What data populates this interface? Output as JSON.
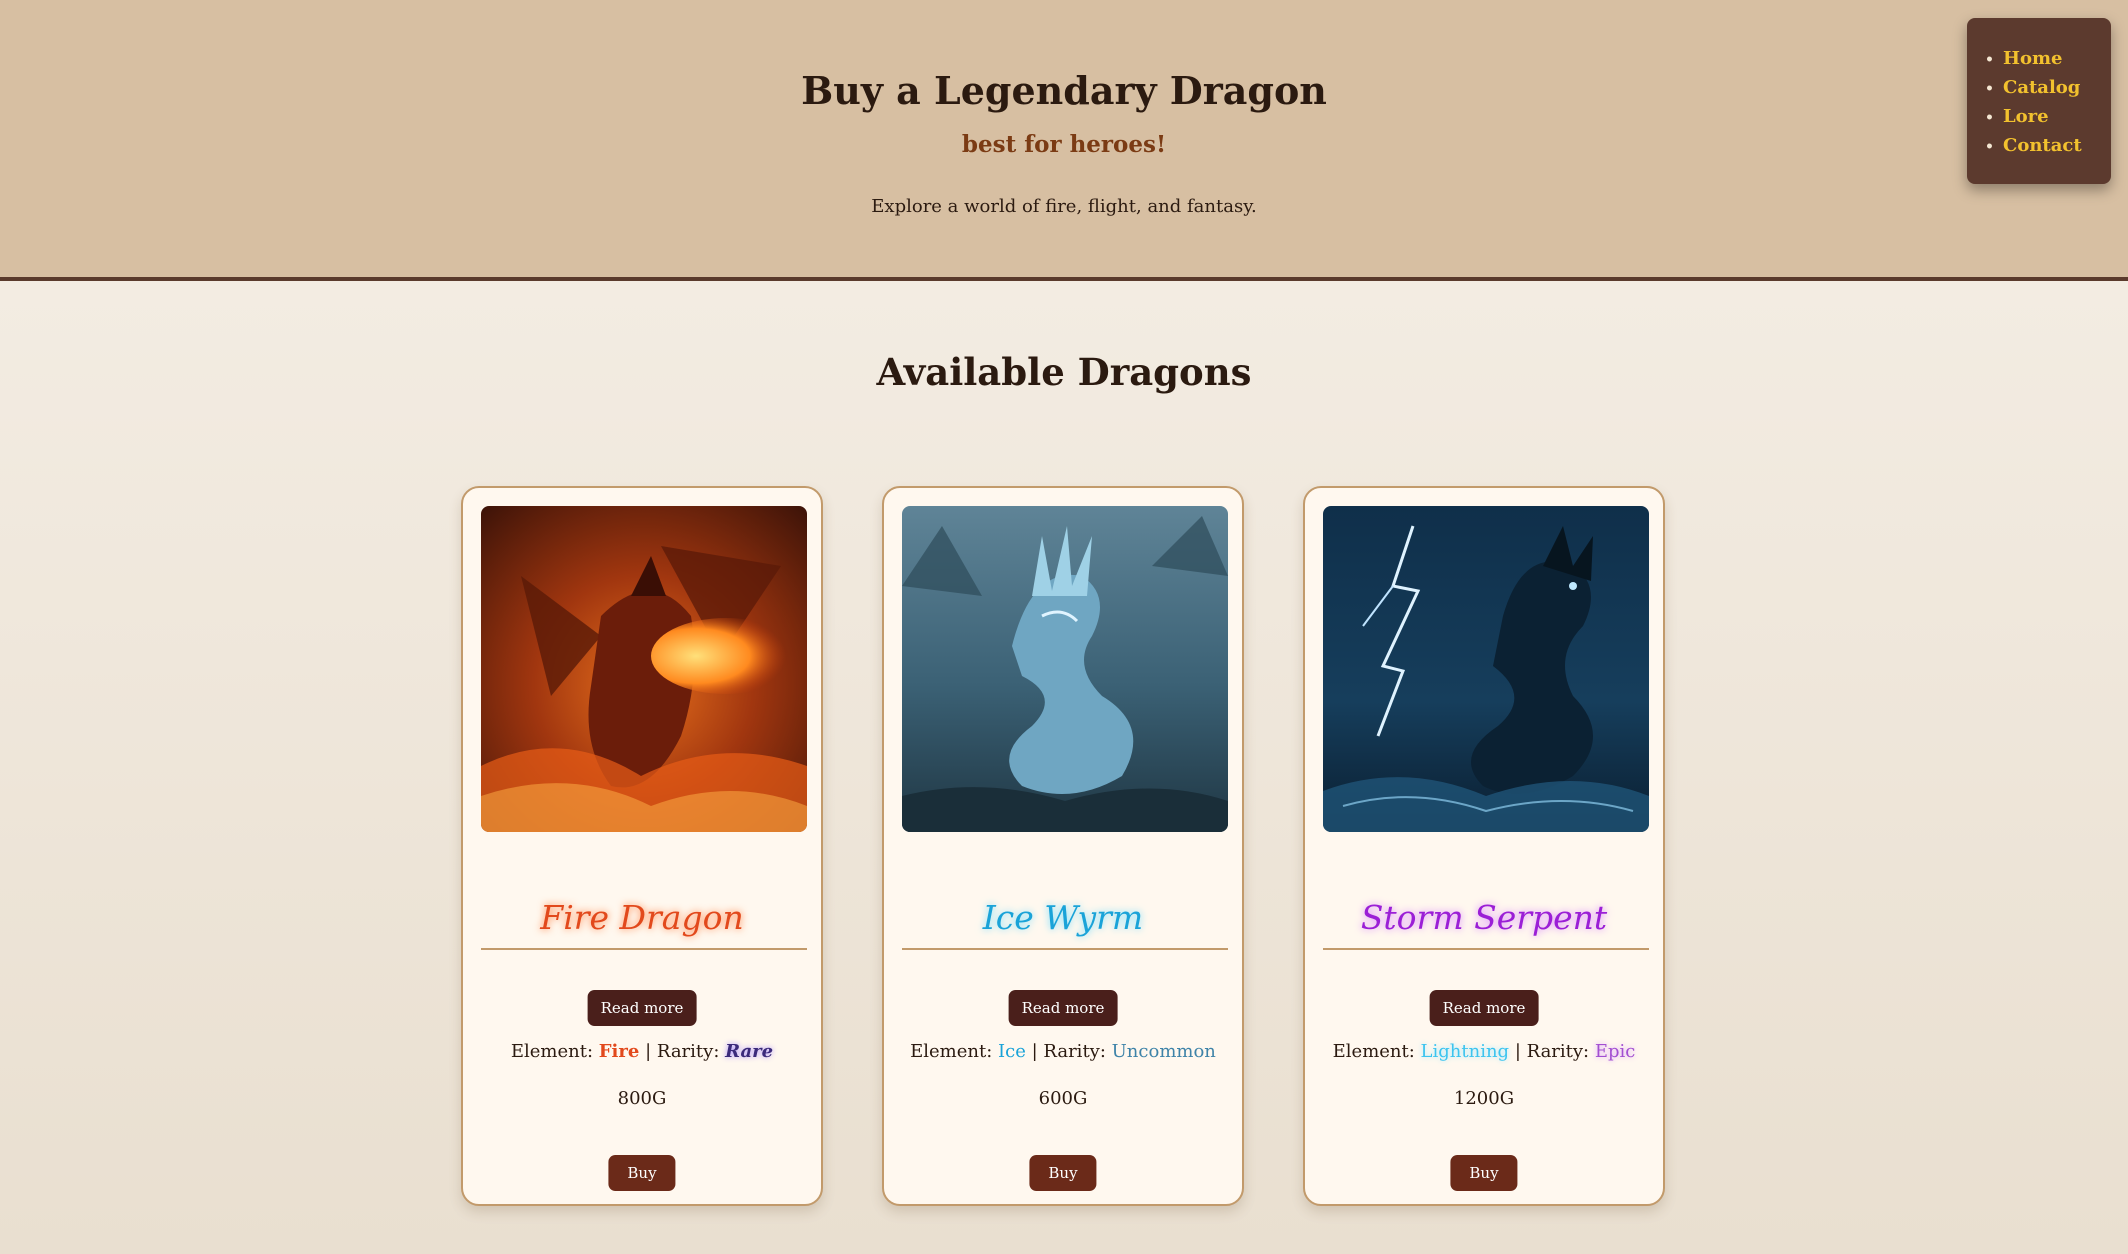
{
  "header": {
    "title": "Buy a Legendary Dragon",
    "tagline": "best for heroes!",
    "intro": "Explore a world of fire, flight, and fantasy."
  },
  "nav": {
    "items": [
      {
        "label": "Home"
      },
      {
        "label": "Catalog"
      },
      {
        "label": "Lore"
      },
      {
        "label": "Contact"
      }
    ]
  },
  "main": {
    "section_title": "Available Dragons",
    "cards": [
      {
        "name": "Fire Dragon",
        "read_more": "Read more",
        "element_label": "Element:",
        "element": "Fire",
        "rarity_label": "| Rarity:",
        "rarity": "Rare",
        "price": "800G",
        "buy_label": "Buy",
        "name_color": "#e2491c",
        "element_color": "#e2491c",
        "rarity_color": "#3b2a7a"
      },
      {
        "name": "Ice Wyrm",
        "read_more": "Read more",
        "element_label": "Element:",
        "element": "Ice",
        "rarity_label": "| Rarity:",
        "rarity": "Uncommon",
        "price": "600G",
        "buy_label": "Buy",
        "name_color": "#1aa3d8",
        "element_color": "#1aa3d8",
        "rarity_color": "#3e83a8"
      },
      {
        "name": "Storm Serpent",
        "read_more": "Read more",
        "element_label": "Element:",
        "element": "Lightning",
        "rarity_label": "| Rarity:",
        "rarity": "Epic",
        "price": "1200G",
        "buy_label": "Buy",
        "name_color": "#9b1fd6",
        "element_color": "#3cc4ef",
        "rarity_color": "#a34fd1"
      }
    ]
  },
  "colors": {
    "header_bg": "#d7bfa2",
    "nav_bg": "#5c3a2e",
    "nav_link": "#f2c12e",
    "read_more_bg": "#4a1f1b",
    "buy_bg": "#6b2a19",
    "card_border": "#c29a6b"
  },
  "icons": {
    "card_images": [
      "fire-dragon-image",
      "ice-wyrm-image",
      "storm-serpent-image"
    ]
  }
}
